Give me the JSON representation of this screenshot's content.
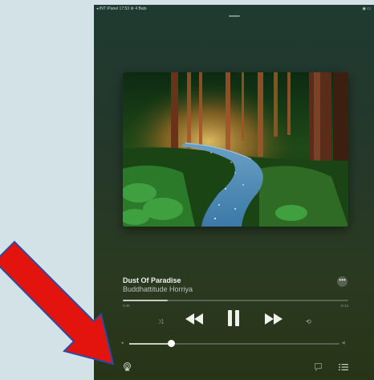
{
  "status_bar": {
    "left_text": "◂ INT iPanel  17:53  ⚙ 4 Bats",
    "right_text": "◉ ▭"
  },
  "track": {
    "title": "Dust Of Paradise",
    "artist": "Buddhattitude Horriya"
  },
  "more_label": "•••",
  "playback": {
    "elapsed": "0:46",
    "remaining": "-5:13",
    "progress_fraction": 0.2
  },
  "volume": {
    "level_fraction": 0.2
  },
  "colors": {
    "arrow": "#e3140d",
    "arrow_outline": "#2c4aa0",
    "background": "#d3e2e6"
  },
  "icons": {
    "shuffle": "shuffle-icon",
    "previous": "previous-track-icon",
    "pause": "pause-icon",
    "next": "next-track-icon",
    "repeat": "repeat-icon",
    "airplay": "airplay-icon",
    "lyrics": "lyrics-icon",
    "queue": "queue-icon"
  }
}
